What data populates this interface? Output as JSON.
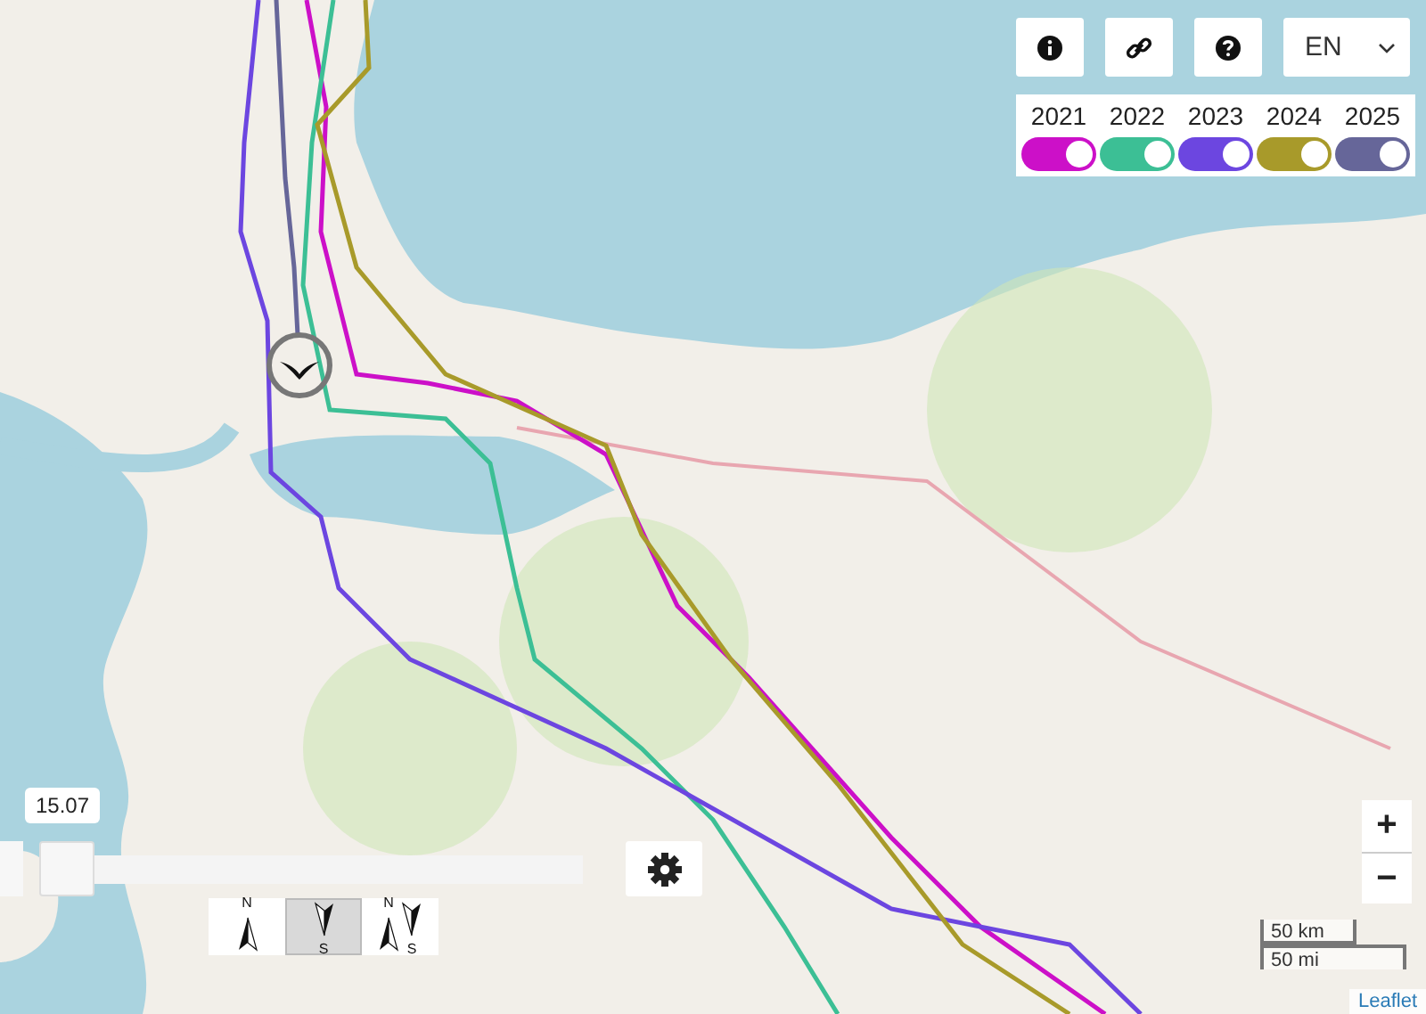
{
  "toolbar": {
    "buttons": [
      {
        "kind": "info"
      },
      {
        "kind": "link"
      },
      {
        "kind": "help"
      }
    ],
    "language": {
      "value": "EN"
    }
  },
  "years": [
    {
      "label": "2021",
      "color": "#cc10c8",
      "on": true
    },
    {
      "label": "2022",
      "color": "#3cbf95",
      "on": true
    },
    {
      "label": "2023",
      "color": "#6c46e0",
      "on": true
    },
    {
      "label": "2024",
      "color": "#a89a2a",
      "on": true
    },
    {
      "label": "2025",
      "color": "#666699",
      "on": true
    }
  ],
  "time_slider": {
    "value_label": "15.07",
    "level": 0
  },
  "compass_modes": [
    {
      "kind": "north",
      "letters": [
        "N"
      ],
      "selected": false
    },
    {
      "kind": "south",
      "letters": [
        "S"
      ],
      "selected": true
    },
    {
      "kind": "both",
      "letters": [
        "N",
        "S"
      ],
      "selected": false
    }
  ],
  "zoom": {
    "zoom_in": "+",
    "zoom_out": "−"
  },
  "scale": {
    "metric": "50 km",
    "imperial": "50 mi"
  },
  "attribution": "Leaflet"
}
